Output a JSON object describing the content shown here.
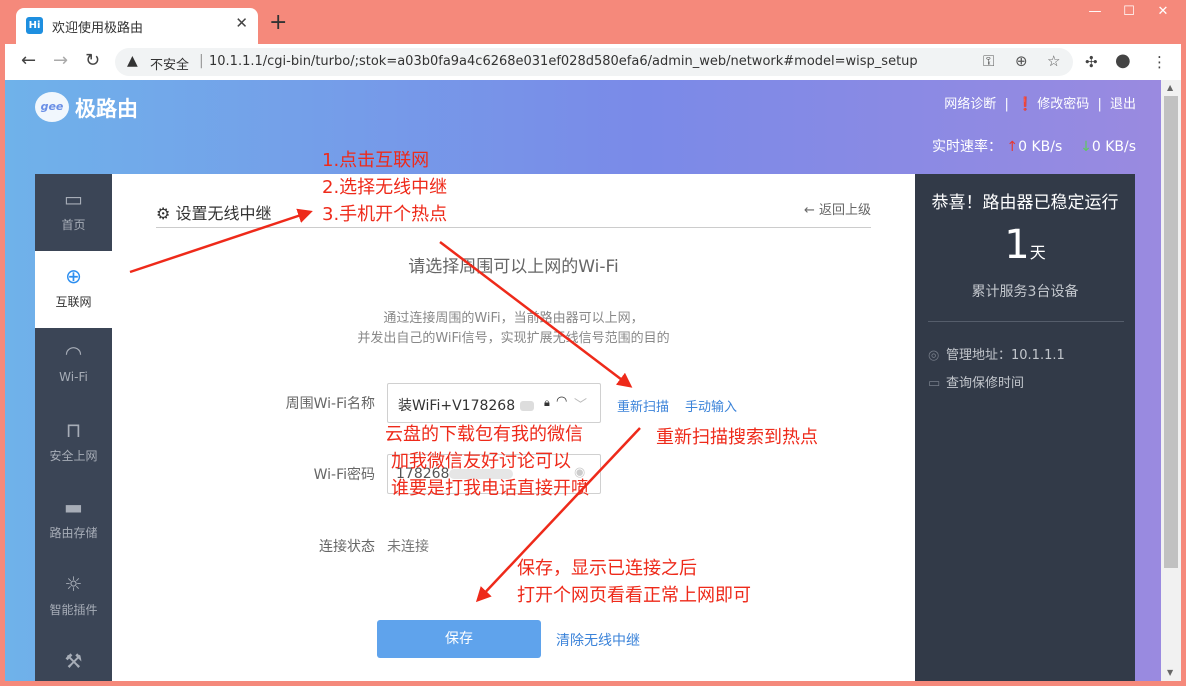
{
  "browser": {
    "tab_title": "欢迎使用极路由",
    "favicon_text": "Hi",
    "tab_close": "✕",
    "new_tab": "+",
    "window_controls": {
      "minimize": "—",
      "maximize": "☐",
      "close": "✕"
    },
    "insecure_label": "不安全",
    "url": "10.1.1.1/cgi-bin/turbo/;stok=a03b0fa9a4c6268e031ef028d580efa6/admin_web/network#model=wisp_setup"
  },
  "header": {
    "logo_mark": "gee",
    "logo_text": "极路由",
    "nav": {
      "diagnose": "网络诊断",
      "change_password": "修改密码",
      "logout": "退出",
      "divider": "|"
    },
    "speed_label": "实时速率：",
    "upload_speed": "0 KB/s",
    "download_speed": "0 KB/s"
  },
  "sidebar": {
    "items": [
      {
        "label": "首页",
        "icon": "monitor-icon"
      },
      {
        "label": "互联网",
        "icon": "globe-icon"
      },
      {
        "label": "Wi-Fi",
        "icon": "wifi-icon"
      },
      {
        "label": "安全上网",
        "icon": "lock-icon"
      },
      {
        "label": "路由存储",
        "icon": "folder-icon"
      },
      {
        "label": "智能插件",
        "icon": "bulb-icon"
      },
      {
        "label": "",
        "icon": "wrench-icon"
      }
    ]
  },
  "main": {
    "title": "设置无线中继",
    "back_label": "返回上级",
    "prompt": "请选择周围可以上网的Wi-Fi",
    "desc_line1": "通过连接周围的WiFi，当前路由器可以上网，",
    "desc_line2": "并发出自己的WiFi信号，实现扩展无线信号范围的目的",
    "wifi_name_label": "周围Wi-Fi名称",
    "wifi_name_value": "装WiFi+V178268",
    "rescan_label": "重新扫描",
    "manual_input_label": "手动输入",
    "wifi_password_label": "Wi-Fi密码",
    "wifi_password_value": "178268",
    "connection_status_label": "连接状态",
    "connection_status_value": "未连接",
    "save_label": "保存",
    "clear_label": "清除无线中继"
  },
  "status_panel": {
    "title": "恭喜！路由器已稳定运行",
    "days_value": "1",
    "days_unit": "天",
    "served_devices": "累计服务3台设备",
    "admin_address": "管理地址：10.1.1.1",
    "warranty_query": "查询保修时间"
  },
  "annotations": {
    "steps": [
      "1.点击互联网",
      "2.选择无线中继",
      "3.手机开个热点"
    ],
    "rescan_note": "重新扫描搜索到热点",
    "download_note": [
      "云盘的下载包有我的微信",
      "加我微信友好讨论可以",
      "谁要是打我电话直接开喷"
    ],
    "save_note": [
      "保存，显示已连接之后",
      "打开个网页看看正常上网即可"
    ],
    "color": "#ee2a1a"
  }
}
